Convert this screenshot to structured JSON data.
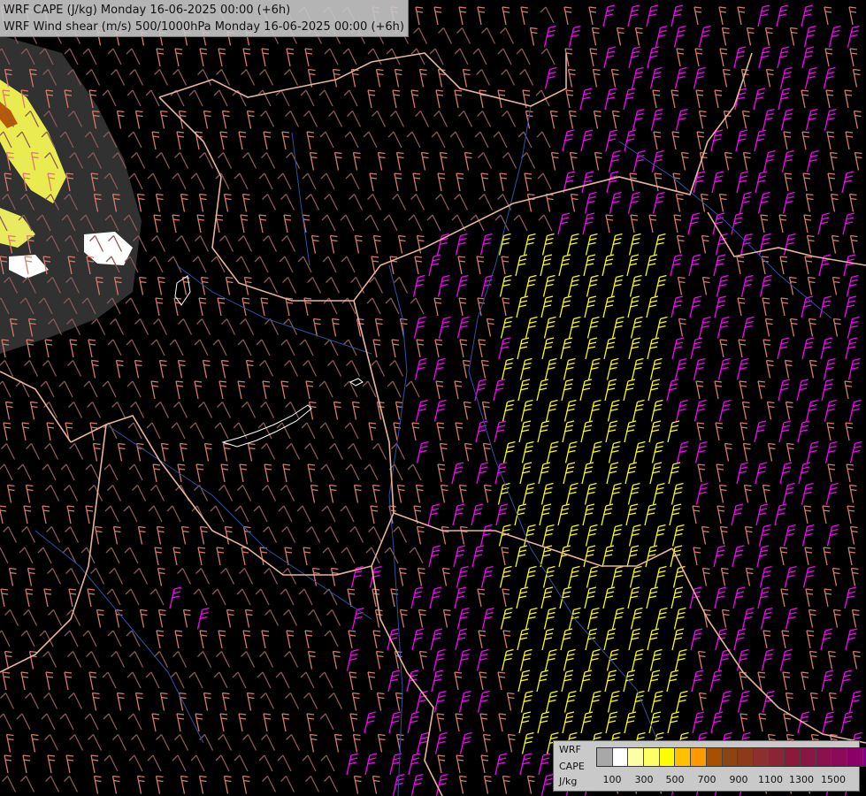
{
  "titles": {
    "line1": "WRF CAPE (J/kg) Monday 16-06-2025 00:00 (+6h)",
    "line2": "WRF Wind shear (m/s) 500/1000hPa Monday 16-06-2025 00:00 (+6h)"
  },
  "legend": {
    "label_lines": [
      "WRF",
      "CAPE",
      "J/kg"
    ],
    "colors": [
      "#a8a8a8",
      "#ffffff",
      "#ffffa8",
      "#ffff66",
      "#ffff00",
      "#ffc000",
      "#ff9900",
      "#a85000",
      "#8b4513",
      "#8b3a1a",
      "#8b2f2f",
      "#8b2535",
      "#8b1a3a",
      "#8b1545",
      "#8b104e",
      "#8b0a5a",
      "#8b0066",
      "#800080"
    ],
    "ticks": [
      "100",
      "300",
      "500",
      "700",
      "900",
      "1100",
      "1300",
      "1500"
    ]
  },
  "barb_colors": {
    "weak": "#8b5a58",
    "moderate": "#d87a6a",
    "strong": "#ff00ff",
    "very_strong": "#ffff00"
  },
  "line_colors": {
    "borders": "#e8b49a",
    "rivers": "#3050a0",
    "lakes": "#ffffff"
  }
}
